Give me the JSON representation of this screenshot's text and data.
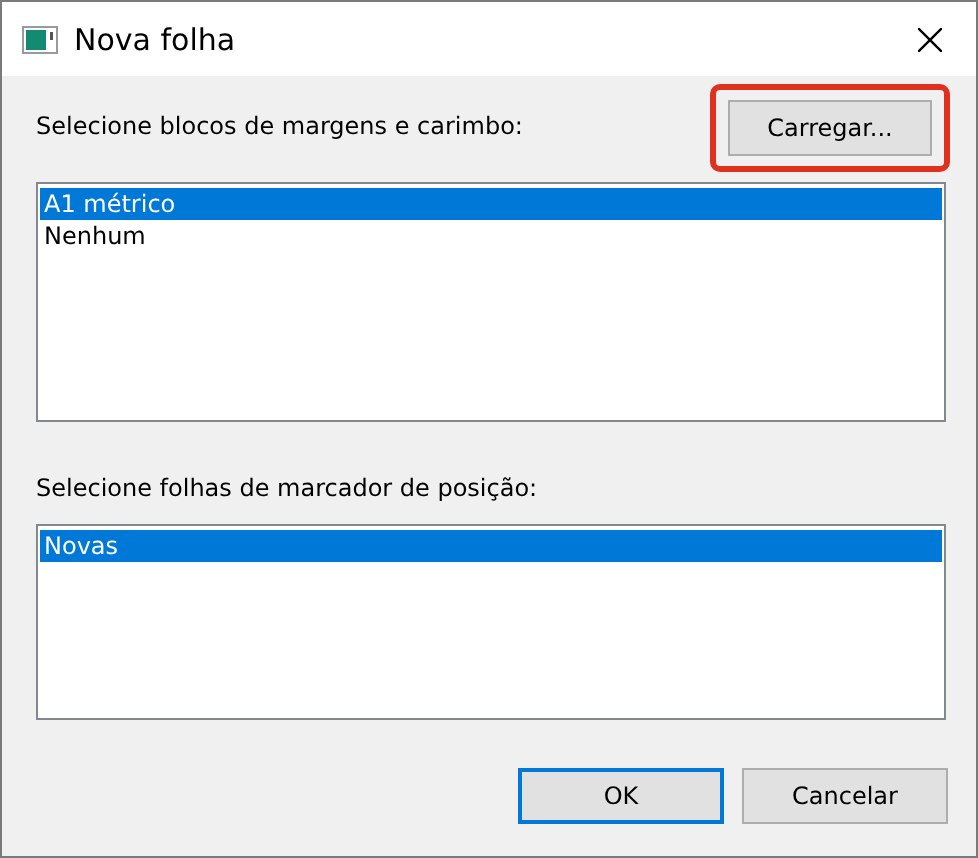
{
  "window": {
    "title": "Nova folha"
  },
  "blocks": {
    "label": "Selecione blocos de margens e carimbo:",
    "load_button": {
      "label": "Carregar...",
      "highlighted": true
    },
    "items": [
      {
        "label": "A1 métrico",
        "selected": true
      },
      {
        "label": "Nenhum",
        "selected": false
      }
    ]
  },
  "sheets": {
    "label": "Selecione folhas de marcador de posição:",
    "items": [
      {
        "label": "Novas",
        "selected": true
      }
    ]
  },
  "buttons": [
    {
      "label": "OK",
      "default": true
    },
    {
      "label": "Cancelar",
      "default": false
    }
  ]
}
